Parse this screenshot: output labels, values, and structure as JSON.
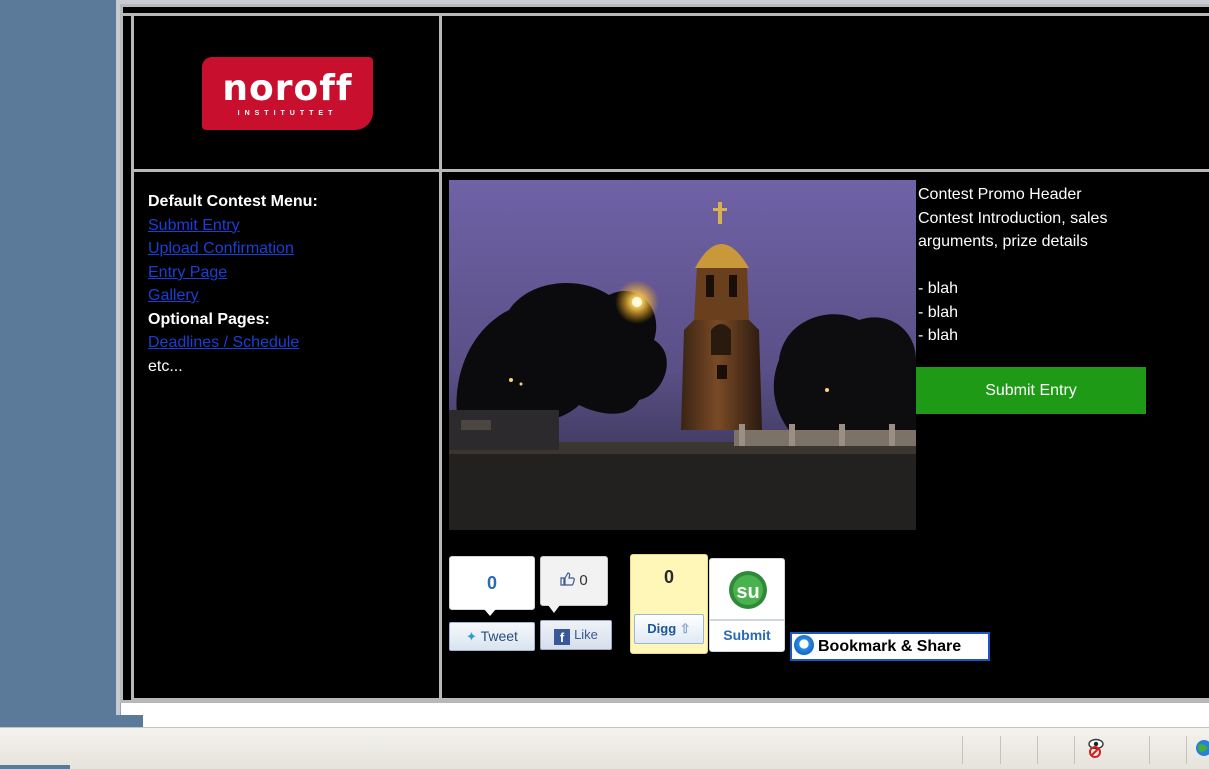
{
  "logo": {
    "word": "noroff",
    "sub": "INSTITUTTET"
  },
  "menu": {
    "heading": "Default Contest Menu:",
    "links": [
      "Submit Entry",
      "Upload Confirmation",
      "Entry Page",
      "Gallery"
    ],
    "optional_heading": "Optional Pages:",
    "optional_links": [
      "Deadlines / Schedule"
    ],
    "etc": "etc..."
  },
  "promo": {
    "header": "Contest Promo Header",
    "intro_line1": "Contest Introduction, sales",
    "intro_line2": "arguments, prize details",
    "bullets": [
      "- blah",
      "- blah",
      "- blah"
    ],
    "submit_label": "Submit Entry"
  },
  "social": {
    "tweet": {
      "count": "0",
      "label": "Tweet"
    },
    "facebook": {
      "count": "0",
      "label": "Like"
    },
    "digg": {
      "count": "0",
      "label": "Digg"
    },
    "stumbleupon": {
      "label": "Submit"
    },
    "bookmark": {
      "label": "Bookmark & Share"
    }
  },
  "colors": {
    "logo_red": "#c8102e",
    "link_blue": "#1a3fd6",
    "submit_green": "#1f9a16",
    "bookmark_border": "#1c55c4"
  },
  "icons": [
    "twitter-bird-icon",
    "thumbs-up-icon",
    "facebook-f-icon",
    "digg-arrow-icon",
    "stumbleupon-icon",
    "bookmark-share-icon",
    "privacy-eye-icon",
    "internet-globe-icon"
  ]
}
